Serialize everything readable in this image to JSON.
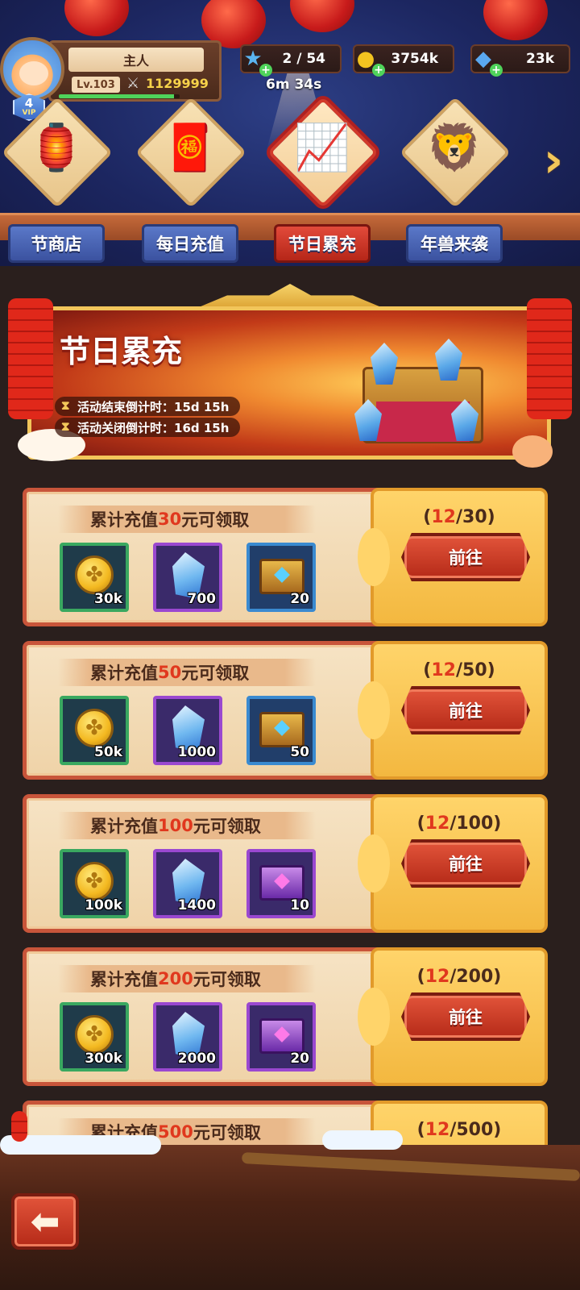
{
  "player": {
    "name": "主人",
    "level": "Lv.103",
    "power": "1129999",
    "vip_level": "4",
    "vip_label": "VIP",
    "xp_progress": 0.95
  },
  "resources": {
    "stamina": "2 / 54",
    "gold": "3754k",
    "gems": "23k",
    "timer": "6m 34s"
  },
  "categories": [
    {
      "label": "节商店",
      "icon": "lantern-gate-icon"
    },
    {
      "label": "每日充值",
      "icon": "gold-coins-envelope-icon"
    },
    {
      "label": "节日累充",
      "icon": "growth-scroll-icon",
      "active": true
    },
    {
      "label": "年兽来袭",
      "icon": "lion-dance-icon"
    }
  ],
  "banner": {
    "title": "节日累充",
    "end_countdown": "活动结束倒计时：15d 15h",
    "close_countdown": "活动关闭倒计时：16d 15h"
  },
  "tasks": [
    {
      "title_prefix": "累计充值",
      "amount": "30",
      "title_suffix": "元可领取",
      "progress_current": "12",
      "progress_total": "/30)",
      "progress_open": "(",
      "button": "前往",
      "rewards": [
        {
          "type": "gold-coin",
          "count": "30k"
        },
        {
          "type": "blue-crystal",
          "count": "700"
        },
        {
          "type": "blue-chest",
          "count": "20"
        }
      ]
    },
    {
      "title_prefix": "累计充值",
      "amount": "50",
      "title_suffix": "元可领取",
      "progress_current": "12",
      "progress_total": "/50)",
      "progress_open": "(",
      "button": "前往",
      "rewards": [
        {
          "type": "gold-coin",
          "count": "50k"
        },
        {
          "type": "blue-crystal",
          "count": "1000"
        },
        {
          "type": "blue-chest",
          "count": "50"
        }
      ]
    },
    {
      "title_prefix": "累计充值",
      "amount": "100",
      "title_suffix": "元可领取",
      "progress_current": "12",
      "progress_total": "/100)",
      "progress_open": "(",
      "button": "前往",
      "rewards": [
        {
          "type": "gold-coin",
          "count": "100k"
        },
        {
          "type": "blue-crystal",
          "count": "1400"
        },
        {
          "type": "purple-chest",
          "count": "10"
        }
      ]
    },
    {
      "title_prefix": "累计充值",
      "amount": "200",
      "title_suffix": "元可领取",
      "progress_current": "12",
      "progress_total": "/200)",
      "progress_open": "(",
      "button": "前往",
      "rewards": [
        {
          "type": "gold-coin",
          "count": "300k"
        },
        {
          "type": "blue-crystal",
          "count": "2000"
        },
        {
          "type": "purple-chest",
          "count": "20"
        }
      ]
    },
    {
      "title_prefix": "累计充值",
      "amount": "500",
      "title_suffix": "元可领取",
      "progress_current": "12",
      "progress_total": "/500)",
      "progress_open": "(",
      "button": "前往",
      "rewards": []
    }
  ],
  "colors": {
    "accent_red": "#e0381e",
    "gold": "#f7d34a",
    "button_red": "#b52a18"
  }
}
